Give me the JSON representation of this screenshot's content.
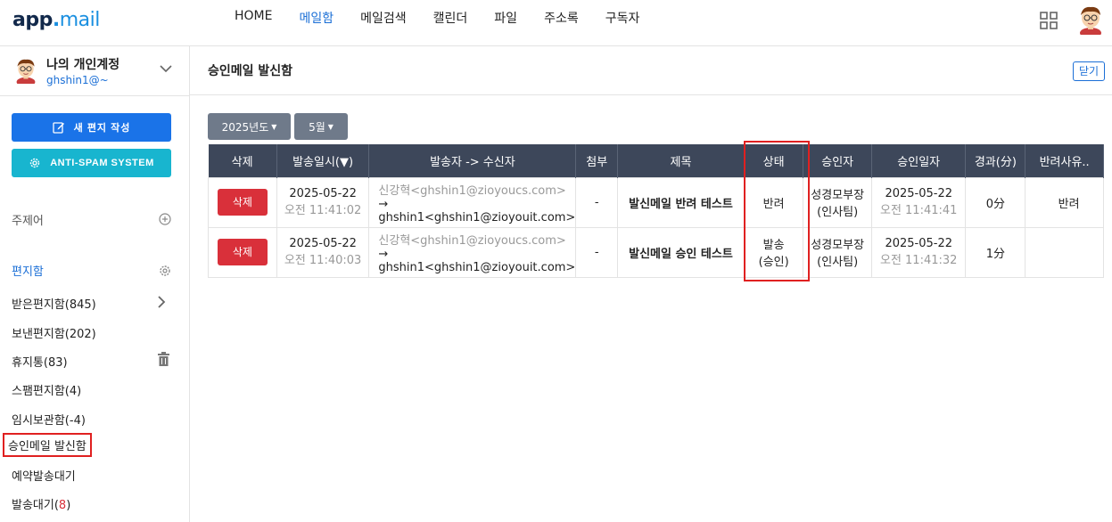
{
  "header": {
    "logo_app": "app",
    "logo_dot": ".",
    "logo_mail": "mail",
    "nav": [
      "HOME",
      "메일함",
      "메일검색",
      "캘린더",
      "파일",
      "주소록",
      "구독자"
    ],
    "active_nav": "메일함"
  },
  "account": {
    "name": "나의 개인계정",
    "email": "ghshin1@~"
  },
  "sidebar": {
    "compose_label": "새 편지 작성",
    "spam_label": "ANTI-SPAM SYSTEM",
    "topics_label": "주제어",
    "mailbox_label": "편지함",
    "folders": [
      {
        "label": "받은편지함(845)"
      },
      {
        "label": "보낸편지함(202)"
      },
      {
        "label": "휴지통(83)"
      },
      {
        "label": "스팸편지함(4)"
      },
      {
        "label": "임시보관함(-4)"
      },
      {
        "label": "승인메일 발신함"
      },
      {
        "label": "예약발송대기"
      },
      {
        "label_prefix": "발송대기(",
        "label_count": "8",
        "label_suffix": ")"
      }
    ]
  },
  "main": {
    "title": "승인메일 발신함",
    "close_label": "닫기",
    "year_filter": "2025년도",
    "month_filter": "5월",
    "columns": [
      "삭제",
      "발송일시(▼)",
      "발송자 -> 수신자",
      "첨부",
      "제목",
      "상태",
      "승인자",
      "승인일자",
      "경과(分)",
      "반려사유.."
    ],
    "rows": [
      {
        "delete_label": "삭제",
        "sent_date": "2025-05-22",
        "sent_time": "오전 11:41:02",
        "sender": "신강혁<ghshin1@zioyoucs.com>",
        "recipient": "→ ghshin1<ghshin1@zioyouit.com>",
        "attach": "-",
        "subject": "발신메일 반려 테스트",
        "status": "반려",
        "status_type": "reject",
        "approver_line1": "성경모부장",
        "approver_line2": "(인사팀)",
        "approved_date": "2025-05-22",
        "approved_time": "오전 11:41:41",
        "elapsed": "0分",
        "reason": "반려"
      },
      {
        "delete_label": "삭제",
        "sent_date": "2025-05-22",
        "sent_time": "오전 11:40:03",
        "sender": "신강혁<ghshin1@zioyoucs.com>",
        "recipient": "→ ghshin1<ghshin1@zioyouit.com>",
        "attach": "-",
        "subject": "발신메일 승인 테스트",
        "status_line1": "발송",
        "status_line2": "(승인)",
        "status_type": "approve",
        "approver_line1": "성경모부장",
        "approver_line2": "(인사팀)",
        "approved_date": "2025-05-22",
        "approved_time": "오전 11:41:32",
        "elapsed": "1分",
        "reason": ""
      }
    ]
  },
  "colors": {
    "accent_blue": "#1a73e8",
    "spam_cyan": "#18b5cf",
    "delete_red": "#d9303a",
    "table_header": "#3d475a",
    "filter_gray": "#6f7a8a"
  }
}
